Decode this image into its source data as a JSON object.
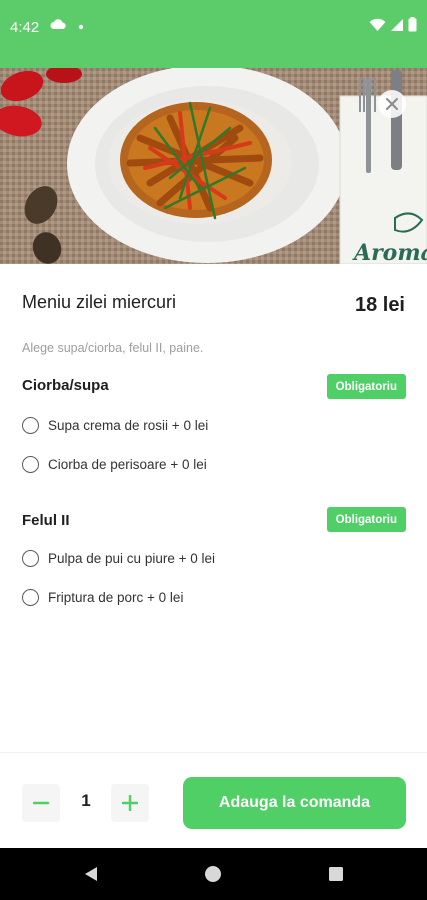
{
  "status_bar": {
    "time": "4:42",
    "left_icons": [
      "cloud-icon",
      "dot-icon"
    ],
    "right_icons": [
      "wifi-icon",
      "signal-icon",
      "battery-icon"
    ]
  },
  "hero": {
    "image": "food-photo",
    "logo_text": "Aroma"
  },
  "dish": {
    "title": "Meniu zilei miercuri",
    "price": "18 lei",
    "description": "Alege supa/ciorba, felul II, paine."
  },
  "groups": [
    {
      "title": "Ciorba/supa",
      "badge": "Obligatoriu",
      "options": [
        {
          "label": "Supa crema de rosii + 0 lei"
        },
        {
          "label": "Ciorba de perisoare + 0 lei"
        }
      ]
    },
    {
      "title": "Felul II",
      "badge": "Obligatoriu",
      "options": [
        {
          "label": "Pulpa de pui cu piure + 0 lei"
        },
        {
          "label": "Friptura de porc + 0 lei"
        }
      ]
    }
  ],
  "order": {
    "quantity": "1",
    "add_label": "Adauga la comanda"
  },
  "colors": {
    "accent": "#4fcf65",
    "status_bar": "#5ccc6a",
    "nav_bar": "#000000"
  }
}
